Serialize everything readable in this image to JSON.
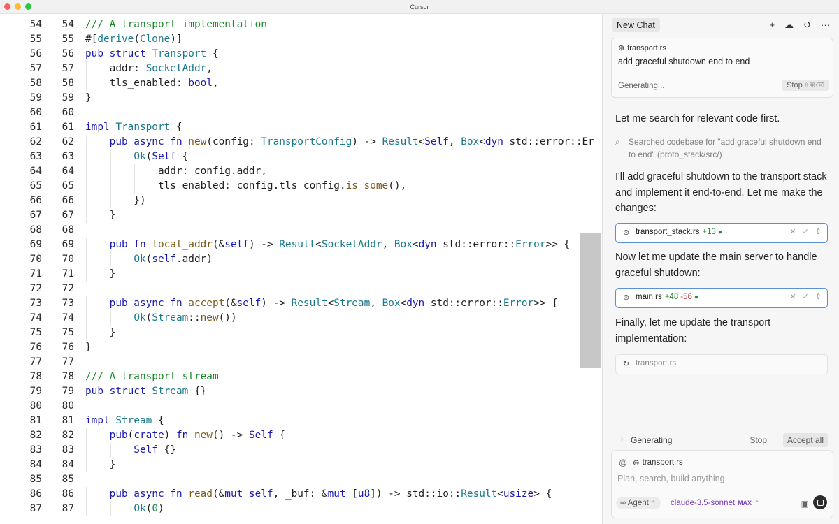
{
  "window": {
    "title": "Cursor"
  },
  "colors": {
    "keyword": "#1a1ab0",
    "type": "#1a7a8c",
    "function": "#7a5c1a",
    "comment": "#1a8a2a",
    "number": "#2a8a5a",
    "plain": "#1f1f1f",
    "accent": "#5b8fd6"
  },
  "editor": {
    "lines": [
      {
        "n": "54",
        "t": [
          [
            "c",
            "/// A transport implementation"
          ]
        ]
      },
      {
        "n": "55",
        "t": [
          [
            "p",
            "#["
          ],
          [
            "t",
            "derive"
          ],
          [
            "p",
            "("
          ],
          [
            "t",
            "Clone"
          ],
          [
            "p",
            ")]"
          ]
        ]
      },
      {
        "n": "56",
        "t": [
          [
            "k",
            "pub struct "
          ],
          [
            "t",
            "Transport"
          ],
          [
            "p",
            " {"
          ]
        ]
      },
      {
        "n": "57",
        "i": 1,
        "t": [
          [
            "p",
            "    addr: "
          ],
          [
            "t",
            "SocketAddr"
          ],
          [
            "p",
            ","
          ]
        ]
      },
      {
        "n": "58",
        "i": 1,
        "t": [
          [
            "p",
            "    tls_enabled: "
          ],
          [
            "k",
            "bool"
          ],
          [
            "p",
            ","
          ]
        ]
      },
      {
        "n": "59",
        "t": [
          [
            "p",
            "}"
          ]
        ]
      },
      {
        "n": "60",
        "t": []
      },
      {
        "n": "61",
        "t": [
          [
            "k",
            "impl "
          ],
          [
            "t",
            "Transport"
          ],
          [
            "p",
            " {"
          ]
        ]
      },
      {
        "n": "62",
        "i": 1,
        "t": [
          [
            "k",
            "    pub async fn "
          ],
          [
            "f",
            "new"
          ],
          [
            "p",
            "(config: "
          ],
          [
            "t",
            "TransportConfig"
          ],
          [
            "p",
            ") -> "
          ],
          [
            "t",
            "Result"
          ],
          [
            "p",
            "<"
          ],
          [
            "k",
            "Self"
          ],
          [
            "p",
            ", "
          ],
          [
            "t",
            "Box"
          ],
          [
            "p",
            "<"
          ],
          [
            "k",
            "dyn "
          ],
          [
            "p",
            "std::error::Er"
          ]
        ]
      },
      {
        "n": "63",
        "i": 2,
        "t": [
          [
            "p",
            "        "
          ],
          [
            "t",
            "Ok"
          ],
          [
            "p",
            "("
          ],
          [
            "k",
            "Self"
          ],
          [
            "p",
            " {"
          ]
        ]
      },
      {
        "n": "64",
        "i": 3,
        "t": [
          [
            "p",
            "            addr: config.addr,"
          ]
        ]
      },
      {
        "n": "65",
        "i": 3,
        "t": [
          [
            "p",
            "            tls_enabled: config.tls_config."
          ],
          [
            "f",
            "is_some"
          ],
          [
            "p",
            "(),"
          ]
        ]
      },
      {
        "n": "66",
        "i": 2,
        "t": [
          [
            "p",
            "        })"
          ]
        ]
      },
      {
        "n": "67",
        "i": 1,
        "t": [
          [
            "p",
            "    }"
          ]
        ]
      },
      {
        "n": "68",
        "t": []
      },
      {
        "n": "69",
        "i": 1,
        "t": [
          [
            "k",
            "    pub fn "
          ],
          [
            "f",
            "local_addr"
          ],
          [
            "p",
            "(&"
          ],
          [
            "k",
            "self"
          ],
          [
            "p",
            ") -> "
          ],
          [
            "t",
            "Result"
          ],
          [
            "p",
            "<"
          ],
          [
            "t",
            "SocketAddr"
          ],
          [
            "p",
            ", "
          ],
          [
            "t",
            "Box"
          ],
          [
            "p",
            "<"
          ],
          [
            "k",
            "dyn "
          ],
          [
            "p",
            "std::error::"
          ],
          [
            "t",
            "Error"
          ],
          [
            "p",
            ">> {"
          ]
        ]
      },
      {
        "n": "70",
        "i": 2,
        "t": [
          [
            "p",
            "        "
          ],
          [
            "t",
            "Ok"
          ],
          [
            "p",
            "("
          ],
          [
            "k",
            "self"
          ],
          [
            "p",
            ".addr)"
          ]
        ]
      },
      {
        "n": "71",
        "i": 1,
        "t": [
          [
            "p",
            "    }"
          ]
        ]
      },
      {
        "n": "72",
        "t": []
      },
      {
        "n": "73",
        "i": 1,
        "t": [
          [
            "k",
            "    pub async fn "
          ],
          [
            "f",
            "accept"
          ],
          [
            "p",
            "(&"
          ],
          [
            "k",
            "self"
          ],
          [
            "p",
            ") -> "
          ],
          [
            "t",
            "Result"
          ],
          [
            "p",
            "<"
          ],
          [
            "t",
            "Stream"
          ],
          [
            "p",
            ", "
          ],
          [
            "t",
            "Box"
          ],
          [
            "p",
            "<"
          ],
          [
            "k",
            "dyn "
          ],
          [
            "p",
            "std::error::"
          ],
          [
            "t",
            "Error"
          ],
          [
            "p",
            ">> {"
          ]
        ]
      },
      {
        "n": "74",
        "i": 2,
        "t": [
          [
            "p",
            "        "
          ],
          [
            "t",
            "Ok"
          ],
          [
            "p",
            "("
          ],
          [
            "t",
            "Stream"
          ],
          [
            "p",
            "::"
          ],
          [
            "f",
            "new"
          ],
          [
            "p",
            "())"
          ]
        ]
      },
      {
        "n": "75",
        "i": 1,
        "t": [
          [
            "p",
            "    }"
          ]
        ]
      },
      {
        "n": "76",
        "t": [
          [
            "p",
            "}"
          ]
        ]
      },
      {
        "n": "77",
        "t": []
      },
      {
        "n": "78",
        "t": [
          [
            "c",
            "/// A transport stream"
          ]
        ]
      },
      {
        "n": "79",
        "t": [
          [
            "k",
            "pub struct "
          ],
          [
            "t",
            "Stream"
          ],
          [
            "p",
            " {}"
          ]
        ]
      },
      {
        "n": "80",
        "t": []
      },
      {
        "n": "81",
        "t": [
          [
            "k",
            "impl "
          ],
          [
            "t",
            "Stream"
          ],
          [
            "p",
            " {"
          ]
        ]
      },
      {
        "n": "82",
        "i": 1,
        "t": [
          [
            "k",
            "    pub"
          ],
          [
            "p",
            "("
          ],
          [
            "k",
            "crate"
          ],
          [
            "p",
            ") "
          ],
          [
            "k",
            "fn "
          ],
          [
            "f",
            "new"
          ],
          [
            "p",
            "() -> "
          ],
          [
            "k",
            "Self"
          ],
          [
            "p",
            " {"
          ]
        ]
      },
      {
        "n": "83",
        "i": 2,
        "t": [
          [
            "k",
            "        Self"
          ],
          [
            "p",
            " {}"
          ]
        ]
      },
      {
        "n": "84",
        "i": 1,
        "t": [
          [
            "p",
            "    }"
          ]
        ]
      },
      {
        "n": "85",
        "t": []
      },
      {
        "n": "86",
        "i": 1,
        "t": [
          [
            "k",
            "    pub async fn "
          ],
          [
            "f",
            "read"
          ],
          [
            "p",
            "(&"
          ],
          [
            "k",
            "mut self"
          ],
          [
            "p",
            ", _buf: &"
          ],
          [
            "k",
            "mut "
          ],
          [
            "p",
            "["
          ],
          [
            "k",
            "u8"
          ],
          [
            "p",
            "]) -> std::io::"
          ],
          [
            "t",
            "Result"
          ],
          [
            "p",
            "<"
          ],
          [
            "k",
            "usize"
          ],
          [
            "p",
            "> {"
          ]
        ]
      },
      {
        "n": "87",
        "i": 2,
        "t": [
          [
            "p",
            "        "
          ],
          [
            "t",
            "Ok"
          ],
          [
            "p",
            "("
          ],
          [
            "n",
            "0"
          ],
          [
            "p",
            ")"
          ]
        ]
      }
    ]
  },
  "chat": {
    "tab_label": "New Chat",
    "header_icons": [
      "+",
      "☁",
      "↺",
      "···"
    ],
    "message": {
      "file_chip": "transport.rs",
      "text": "add graceful shutdown end to end",
      "status": "Generating...",
      "stop_label": "Stop",
      "stop_keys": "⇧⌘⌫"
    },
    "para1": "Let me search for relevant code first.",
    "search_result": "Searched codebase for \"add graceful shutdown end to end\" (proto_stack/src/)",
    "para2": "I'll add graceful shutdown to the transport stack and implement it end-to-end. Let me make the changes:",
    "file1": {
      "name": "transport_stack.rs",
      "added": "+13",
      "dot": "●"
    },
    "para3": "Now let me update the main server to handle graceful shutdown:",
    "file2": {
      "name": "main.rs",
      "added": "+48",
      "removed": "-56",
      "dot": "●"
    },
    "para4": "Finally, let me update the transport implementation:",
    "file3": {
      "name": "transport.rs"
    },
    "bottom_bar": {
      "generating": "Generating",
      "stop": "Stop",
      "accept_all": "Accept all"
    },
    "composer": {
      "at": "@",
      "file_chip": "transport.rs",
      "placeholder": "Plan, search, build anything",
      "agent_label": "∞ Agent",
      "model": "claude-3.5-sonnet",
      "model_badge": "MAX"
    }
  }
}
